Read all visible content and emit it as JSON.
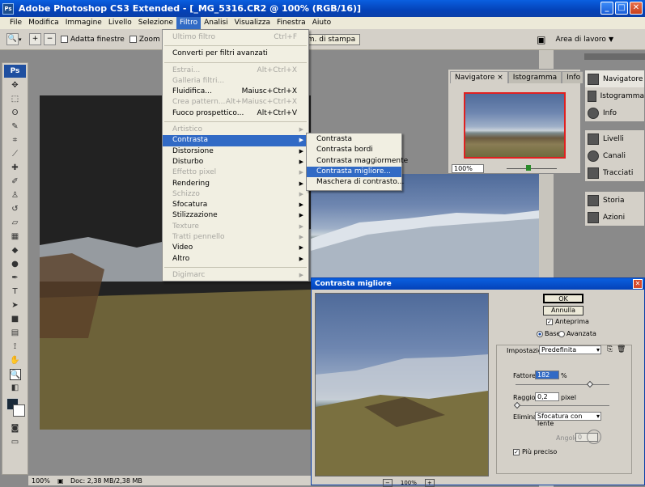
{
  "titlebar": {
    "title": "Adobe Photoshop CS3 Extended - [_MG_5316.CR2 @ 100% (RGB/16)]",
    "icon": "Ps"
  },
  "menubar": {
    "items": [
      "File",
      "Modifica",
      "Immagine",
      "Livello",
      "Selezione",
      "Filtro",
      "Analisi",
      "Visualizza",
      "Finestra",
      "Aiuto"
    ]
  },
  "options": {
    "fit_window": "Adatta finestre",
    "zoom_label": "Zoom d",
    "print_size": "Dim. di stampa",
    "workspace": "Area di lavoro"
  },
  "filter_menu": {
    "group1": [
      {
        "label": "Ultimo filtro",
        "shortcut": "Ctrl+F",
        "disabled": true
      }
    ],
    "group2": [
      {
        "label": "Converti per filtri avanzati",
        "shortcut": "",
        "disabled": false
      }
    ],
    "group3": [
      {
        "label": "Estrai...",
        "shortcut": "Alt+Ctrl+X",
        "disabled": true
      },
      {
        "label": "Galleria filtri...",
        "shortcut": "",
        "disabled": true
      },
      {
        "label": "Fluidifica...",
        "shortcut": "Maiusc+Ctrl+X",
        "disabled": false
      },
      {
        "label": "Crea pattern...",
        "shortcut": "Alt+Maiusc+Ctrl+X",
        "disabled": true
      },
      {
        "label": "Fuoco prospettico...",
        "shortcut": "Alt+Ctrl+V",
        "disabled": false
      }
    ],
    "group4": [
      {
        "label": "Artistico",
        "disabled": true
      },
      {
        "label": "Contrasta",
        "disabled": false,
        "highlight": true
      },
      {
        "label": "Distorsione",
        "disabled": false
      },
      {
        "label": "Disturbo",
        "disabled": false
      },
      {
        "label": "Effetto pixel",
        "disabled": true
      },
      {
        "label": "Rendering",
        "disabled": false
      },
      {
        "label": "Schizzo",
        "disabled": true
      },
      {
        "label": "Sfocatura",
        "disabled": false
      },
      {
        "label": "Stilizzazione",
        "disabled": false
      },
      {
        "label": "Texture",
        "disabled": true
      },
      {
        "label": "Tratti pennello",
        "disabled": true
      },
      {
        "label": "Video",
        "disabled": false
      },
      {
        "label": "Altro",
        "disabled": false
      }
    ],
    "group5": [
      {
        "label": "Digimarc",
        "disabled": true
      }
    ]
  },
  "submenu": {
    "items": [
      "Contrasta",
      "Contrasta bordi",
      "Contrasta maggiormente",
      "Contrasta migliore...",
      "Maschera di contrasto..."
    ],
    "highlight_index": 3
  },
  "navigator": {
    "tabs": [
      "Navigatore",
      "Istogramma",
      "Info"
    ],
    "zoom": "100%"
  },
  "right_dock": {
    "group1": [
      "Navigatore",
      "Istogramma",
      "Info"
    ],
    "group2": [
      "Livelli",
      "Canali",
      "Tracciati"
    ],
    "group3": [
      "Storia",
      "Azioni"
    ]
  },
  "status": {
    "zoom": "100%",
    "doc": "Doc: 2,38 MB/2,38 MB"
  },
  "dialog": {
    "title": "Contrasta migliore",
    "ok": "OK",
    "cancel": "Annulla",
    "preview": "Anteprima",
    "mode_base": "Base",
    "mode_advanced": "Avanzata",
    "settings_label": "Impostazioni:",
    "settings_value": "Predefinita",
    "amount_label": "Fattore:",
    "amount_value": "182",
    "amount_unit": "%",
    "radius_label": "Raggio:",
    "radius_value": "0,2",
    "radius_unit": "pixel",
    "remove_label": "Elimina:",
    "remove_value": "Sfocatura con lente",
    "angle_label": "Angolo:",
    "angle_value": "0",
    "more_accurate": "Più preciso",
    "preview_zoom": "100%"
  }
}
